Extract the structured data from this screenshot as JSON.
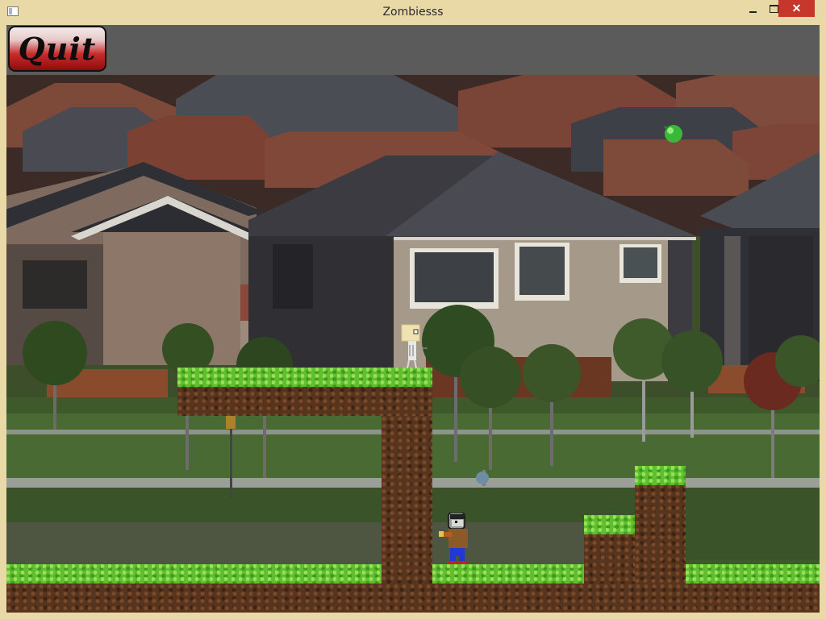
{
  "window": {
    "title": "Zombiesss",
    "minimize_label": "",
    "maximize_label": "",
    "close_label": "✕"
  },
  "hud": {
    "quit_label": "Quit"
  },
  "colors": {
    "frame": "#e9d9a6",
    "hud": "#5b5b5b",
    "grass": "#5fbf2e",
    "dirt": "#56341d",
    "close_button": "#c7362b",
    "quit_button": "#b41e1e"
  },
  "sprites": {
    "player": "zombie-player-sprite",
    "npc": "survivor-sprite",
    "pickup": "green-orb-icon"
  }
}
